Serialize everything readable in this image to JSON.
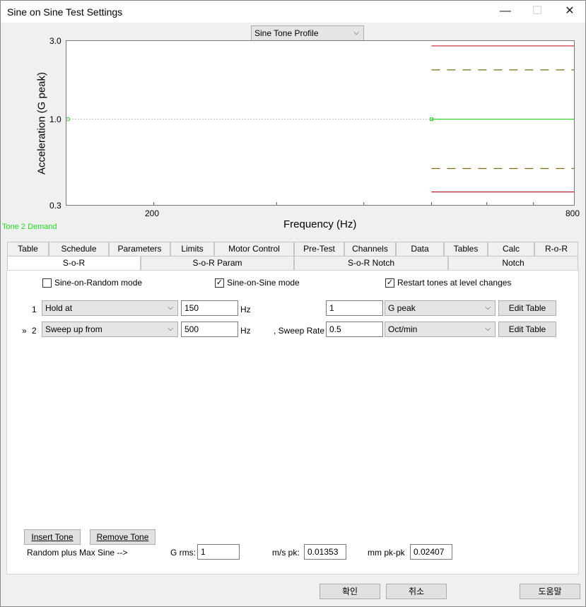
{
  "window": {
    "title": "Sine on Sine Test Settings",
    "minimize": "—",
    "maximize": "☐",
    "close": "✕"
  },
  "profile_select": "Sine Tone Profile",
  "chart_data": {
    "type": "line",
    "xlabel": "Frequency (Hz)",
    "ylabel": "Acceleration (G peak)",
    "x_ticks": [
      "200",
      "800"
    ],
    "y_ticks": [
      "3.0",
      "1.0",
      "0.3"
    ],
    "xlim": [
      150,
      800
    ],
    "ylim": [
      0.3,
      3.0
    ],
    "yscale": "log",
    "xscale": "log",
    "series": [
      {
        "name": "Tone 2 Demand",
        "x": [
          500,
          800
        ],
        "y": [
          1.0,
          1.0
        ],
        "color": "#22cc22"
      },
      {
        "x": [
          500,
          800
        ],
        "y": [
          2.8,
          2.8
        ],
        "color": "#c0202a"
      },
      {
        "x": [
          500,
          800
        ],
        "y": [
          0.36,
          0.36
        ],
        "color": "#c0202a"
      },
      {
        "x": [
          500,
          800
        ],
        "y": [
          2.0,
          2.0
        ],
        "color": "#7a6a10",
        "dash": true
      },
      {
        "x": [
          500,
          800
        ],
        "y": [
          0.5,
          0.5
        ],
        "color": "#7a6a10",
        "dash": true
      }
    ],
    "reference_line": {
      "y": 1.0,
      "color": "#bbbbbb"
    }
  },
  "demand_label": "Tone 2 Demand",
  "tabs_row1": [
    "Table",
    "Schedule",
    "Parameters",
    "Limits",
    "Motor Control",
    "Pre-Test",
    "Channels",
    "Data",
    "Tables",
    "Calc",
    "R-o-R"
  ],
  "tabs_row2": [
    "S-o-R",
    "S-o-R Param",
    "S-o-R Notch",
    "Notch"
  ],
  "checks": {
    "sor": {
      "label": "Sine-on-Random mode",
      "checked": ""
    },
    "sos": {
      "label": "Sine-on-Sine mode",
      "checked": "✓"
    },
    "restart": {
      "label": "Restart tones at level changes",
      "checked": "✓"
    }
  },
  "tones": [
    {
      "marker": "",
      "num": "1",
      "mode": "Hold at",
      "freq": "150",
      "unit": "Hz",
      "extra_label": "",
      "value": "1",
      "value_unit": "G peak",
      "edit": "Edit Table"
    },
    {
      "marker": "»",
      "num": "2",
      "mode": "Sweep up from",
      "freq": "500",
      "unit": "Hz",
      "extra_label": ", Sweep Rate",
      "value": "0.5",
      "value_unit": "Oct/min",
      "edit": "Edit Table"
    }
  ],
  "insert_tone": "Insert Tone",
  "remove_tone": "Remove Tone",
  "summary": {
    "label": "Random plus Max Sine -->",
    "grms_label": "G rms:",
    "grms_value": "1",
    "ms_label": "m/s pk:",
    "ms_value": "0.01353",
    "mm_label": "mm pk-pk",
    "mm_value": "0.02407"
  },
  "footer": {
    "ok": "확인",
    "cancel": "취소",
    "help": "도움말"
  }
}
